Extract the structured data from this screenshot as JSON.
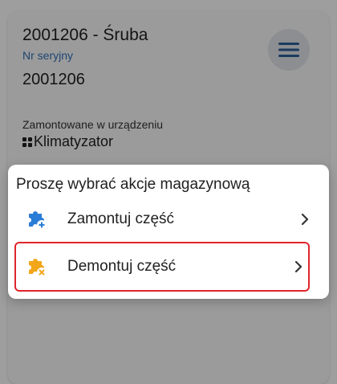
{
  "part": {
    "title": "2001206 - Śruba",
    "serial_label": "Nr seryjny",
    "serial_value": "2001206",
    "mounted_label": "Zamontowane w urządzeniu",
    "device_name": "Klimatyzator"
  },
  "dialog": {
    "title": "Proszę wybrać akcje magazynową",
    "actions": [
      {
        "label": "Zamontuj część",
        "icon": "puzzle-plus-icon",
        "color": "#2a7dd6"
      },
      {
        "label": "Demontuj część",
        "icon": "puzzle-remove-icon",
        "color": "#f2a71b",
        "highlighted": true
      }
    ]
  },
  "colors": {
    "link_blue": "#2f6fb6",
    "menu_icon": "#2b5f96",
    "highlight_border": "#e0242b"
  }
}
